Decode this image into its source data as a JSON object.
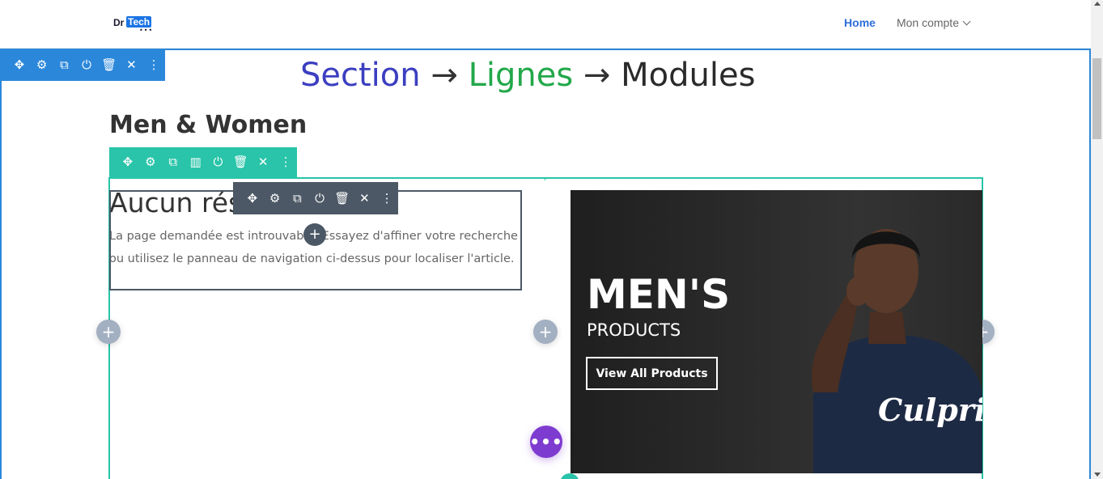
{
  "header": {
    "logo": {
      "part1": "Dr",
      "part2": "Tech",
      "dots": "•••"
    },
    "nav": {
      "home": "Home",
      "account": "Mon compte"
    }
  },
  "toolbars": {
    "section": [
      "✥",
      "⚙",
      "⧉",
      "⏻",
      "🗑",
      "✕",
      "⋮"
    ],
    "row": [
      "✥",
      "⚙",
      "⧉",
      "▥",
      "⏻",
      "🗑",
      "✕",
      "⋮"
    ],
    "module": [
      "✥",
      "⚙",
      "⧉",
      "⏻",
      "🗑",
      "✕",
      "⋮"
    ]
  },
  "annotation": {
    "section": "Section",
    "arrow": "→",
    "lignes": "Lignes",
    "modules": "Modules",
    "colors": {
      "section": "#3c3fc0",
      "lignes": "#22a84a",
      "modules": "#2a2a2a"
    }
  },
  "section": {
    "heading": "Men & Women"
  },
  "text_module": {
    "title": "Aucun rés",
    "body": "La page demandée est introuvable. Essayez d'affiner votre recherche ou utilisez le panneau de navigation ci-dessus pour localiser l'article."
  },
  "promo": {
    "title": "MEN'S",
    "subtitle": "PRODUCTS",
    "button": "View All Products",
    "shirt_text": "Culprit"
  },
  "buttons": {
    "add": "+",
    "more": "•••"
  },
  "colors": {
    "section_accent": "#2b87da",
    "row_accent": "#29c4a9",
    "module_accent": "#4c5866",
    "fab": "#7e3bd0",
    "nav_active": "#2e6edb"
  }
}
